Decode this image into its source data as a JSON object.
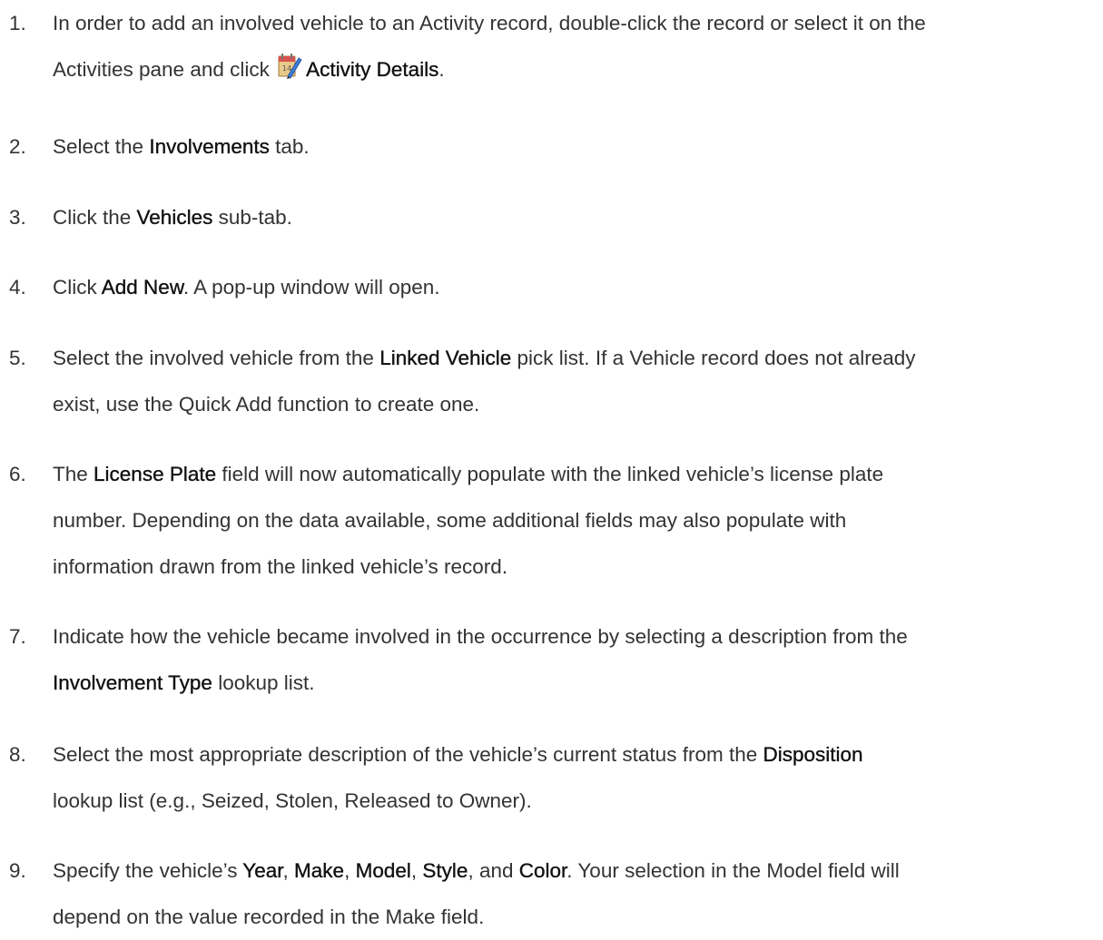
{
  "steps": [
    {
      "number": "1.",
      "lines": [
        [
          {
            "t": "In order to add an involved vehicle to an Activity record, double-click the record or select it on the"
          }
        ],
        [
          {
            "t": "Activities pane and click "
          },
          {
            "icon": "activity-details-icon"
          },
          {
            "t": "Activity Details",
            "b": true
          },
          {
            "t": "."
          }
        ]
      ]
    },
    {
      "number": "2.",
      "lines": [
        [
          {
            "t": "Select the "
          },
          {
            "t": "Involvements",
            "b": true
          },
          {
            "t": " tab."
          }
        ]
      ]
    },
    {
      "number": "3.",
      "lines": [
        [
          {
            "t": "Click the "
          },
          {
            "t": "Vehicles",
            "b": true
          },
          {
            "t": " sub-tab."
          }
        ]
      ]
    },
    {
      "number": "4.",
      "lines": [
        [
          {
            "t": "Click "
          },
          {
            "t": "Add New",
            "b": true
          },
          {
            "t": ". A pop-up window will open."
          }
        ]
      ]
    },
    {
      "number": "5.",
      "lines": [
        [
          {
            "t": "Select the involved vehicle from the "
          },
          {
            "t": "Linked Vehicle",
            "b": true
          },
          {
            "t": " pick list. If a Vehicle record does not already"
          }
        ],
        [
          {
            "t": "exist, use the Quick Add function to create one."
          }
        ]
      ]
    },
    {
      "number": "6.",
      "lines": [
        [
          {
            "t": "The "
          },
          {
            "t": "License Plate",
            "b": true
          },
          {
            "t": " field will now automatically populate with the linked vehicle’s license plate"
          }
        ],
        [
          {
            "t": "number. Depending on the data available, some additional fields may also populate with"
          }
        ],
        [
          {
            "t": "information drawn from the linked vehicle’s record."
          }
        ]
      ]
    },
    {
      "number": "7.",
      "lines": [
        [
          {
            "t": "Indicate how the vehicle became involved in the occurrence by selecting a description from the"
          }
        ],
        [
          {
            "t": "Involvement Type",
            "b": true
          },
          {
            "t": " lookup list."
          }
        ]
      ]
    },
    {
      "number": "8.",
      "lines": [
        [
          {
            "t": "Select the most appropriate description of the vehicle’s current status from the "
          },
          {
            "t": "Disposition",
            "b": true
          }
        ],
        [
          {
            "t": "lookup list (e.g., Seized, Stolen, Released to Owner)."
          }
        ]
      ]
    },
    {
      "number": "9.",
      "lines": [
        [
          {
            "t": "Specify the vehicle’s "
          },
          {
            "t": "Year",
            "b": true
          },
          {
            "t": ", "
          },
          {
            "t": "Make",
            "b": true
          },
          {
            "t": ", "
          },
          {
            "t": "Model",
            "b": true
          },
          {
            "t": ", "
          },
          {
            "t": "Style",
            "b": true
          },
          {
            "t": ", and "
          },
          {
            "t": "Color",
            "b": true
          },
          {
            "t": ". Your selection in the Model field will"
          }
        ],
        [
          {
            "t": "depend on the value recorded in the Make field."
          }
        ]
      ]
    }
  ]
}
